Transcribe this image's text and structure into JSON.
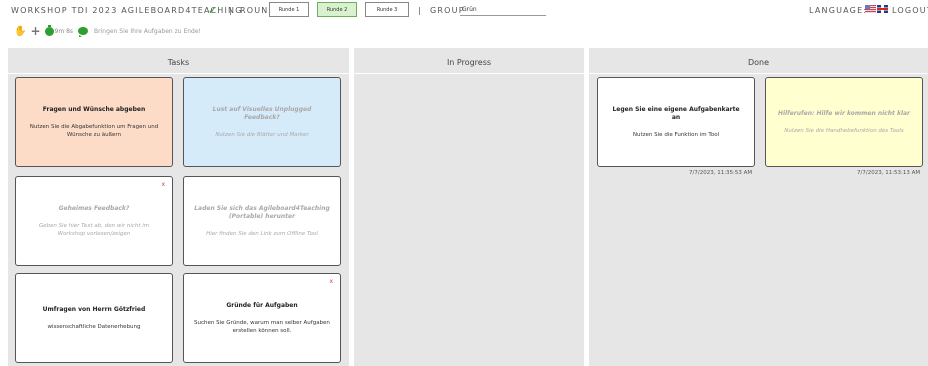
{
  "header": {
    "title": "WORKSHOP TDI 2023 AGILEBOARD4TEACHING",
    "separator": "|",
    "round_label": "ROUND",
    "rounds": [
      {
        "label": "Runde 1",
        "active": false
      },
      {
        "label": "Runde 2",
        "active": true
      },
      {
        "label": "Runde 3",
        "active": false
      }
    ],
    "group_label": "GROUP",
    "group_value": "Grün",
    "language_label": "LANGUAGE:",
    "logout_label": "LOGOUT"
  },
  "toolbar": {
    "timer_text": "9m 8s",
    "hint_text": "Bringen Sie Ihre Aufgaben zu Ende!"
  },
  "colors": {
    "accent_green": "#2e9e2e",
    "card_orange": "#fcdcc7",
    "card_blue": "#d6ebfa",
    "card_yellow": "#ffffcf",
    "column_bg": "#e6e6e6",
    "delete_red": "#d93a3a"
  },
  "columns": {
    "tasks": {
      "title": "Tasks",
      "cards": [
        {
          "title": "Fragen und Wünsche abgeben",
          "text": "Nutzen Sie die Abgabefunktion um Fragen und Wünsche zu äußern",
          "color": "orange",
          "faded": false
        },
        {
          "title": "Lust auf Visuelles Unplugged Feedback?",
          "text": "Nutzen Sie die Blätter und Marker",
          "color": "blue",
          "faded": true
        },
        {
          "title": "Geheimes Feedback?",
          "text": "Geben Sie hier Text ab, den wir nicht im Workshop vorlesen/zeigen",
          "color": "white",
          "faded": true,
          "delete": "x"
        },
        {
          "title": "Laden Sie sich das Agileboard4Teaching (Portable) herunter",
          "text": "Hier finden Sie den Link zum Offline Tool",
          "color": "white",
          "faded": true
        },
        {
          "title": "Umfragen von Herrn Götzfried",
          "text": "wissenschaftliche Datenerhebung",
          "color": "white",
          "faded": false
        },
        {
          "title": "Gründe für Aufgaben",
          "text": "Suchen Sie Gründe, warum man selber Aufgaben erstellen können soll.",
          "color": "white",
          "faded": false,
          "delete": "x"
        }
      ]
    },
    "in_progress": {
      "title": "In Progress",
      "cards": []
    },
    "done": {
      "title": "Done",
      "cards": [
        {
          "title": "Legen Sie eine eigene Aufgabenkarte an",
          "text": "Nutzen Sie die Funktion im Tool",
          "color": "white",
          "faded": false,
          "timestamp": "7/7/2023, 11:35:53 AM"
        },
        {
          "title": "Hilferufen: Hilfe wir kommen nicht klar",
          "text": "Nutzen Sie die Handhebefunktion des Tools",
          "color": "yellow",
          "faded": true,
          "timestamp": "7/7/2023, 11:53:13 AM"
        }
      ]
    }
  }
}
